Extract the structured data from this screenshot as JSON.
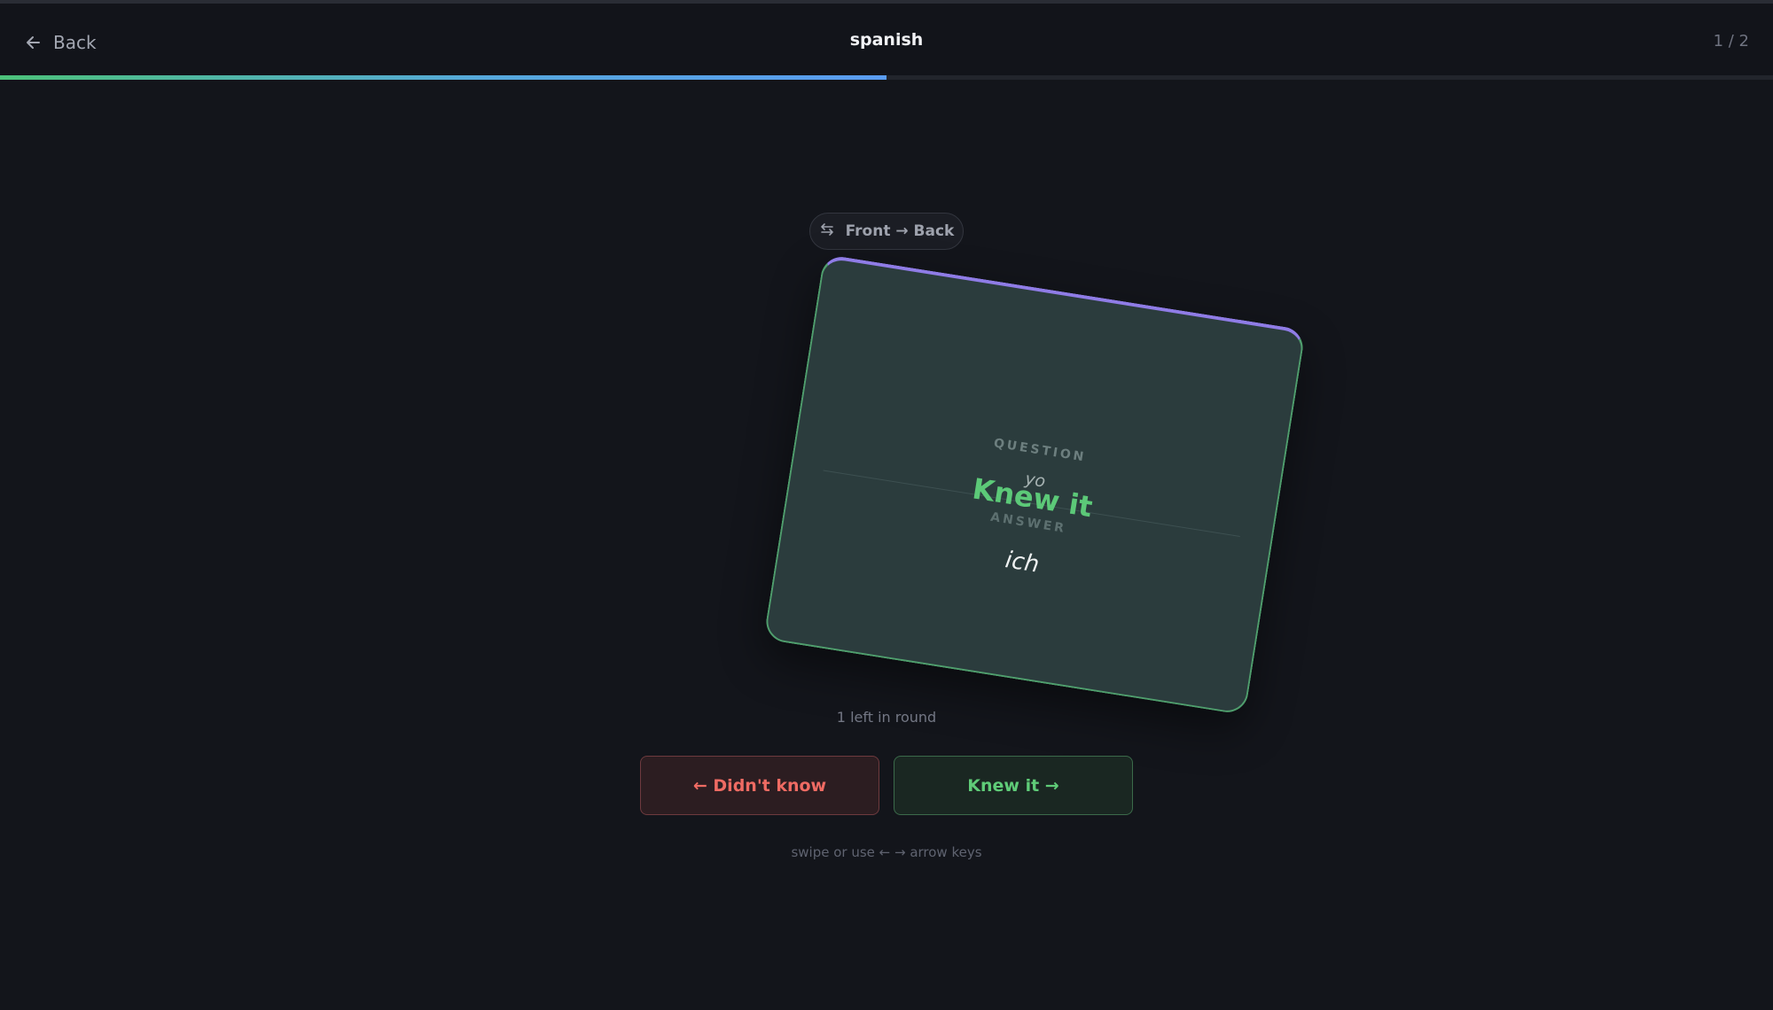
{
  "header": {
    "back_label": "Back",
    "title": "spanish",
    "counter": "1 / 2"
  },
  "progress": {
    "fraction": 0.5
  },
  "direction": {
    "label": "Front → Back",
    "icon": "swap-arrows-icon"
  },
  "card": {
    "question_label": "QUESTION",
    "question": "yo",
    "answer_label": "ANSWER",
    "answer": "ich",
    "swipe_overlay": "Knew it"
  },
  "status": {
    "remaining": "1 left in round"
  },
  "actions": {
    "didnt_know": "← Didn't know",
    "knew_it": "Knew it →"
  },
  "hint": "swipe or use ← → arrow keys",
  "colors": {
    "background": "#13151b",
    "card": "#2b3c3d",
    "card_border": "#4f9e6d",
    "card_top_accent": "#8f7ce6",
    "positive": "#5fcc78",
    "negative": "#ef6b63",
    "progress_start": "#4cc27a",
    "progress_end": "#5a9cf0"
  }
}
